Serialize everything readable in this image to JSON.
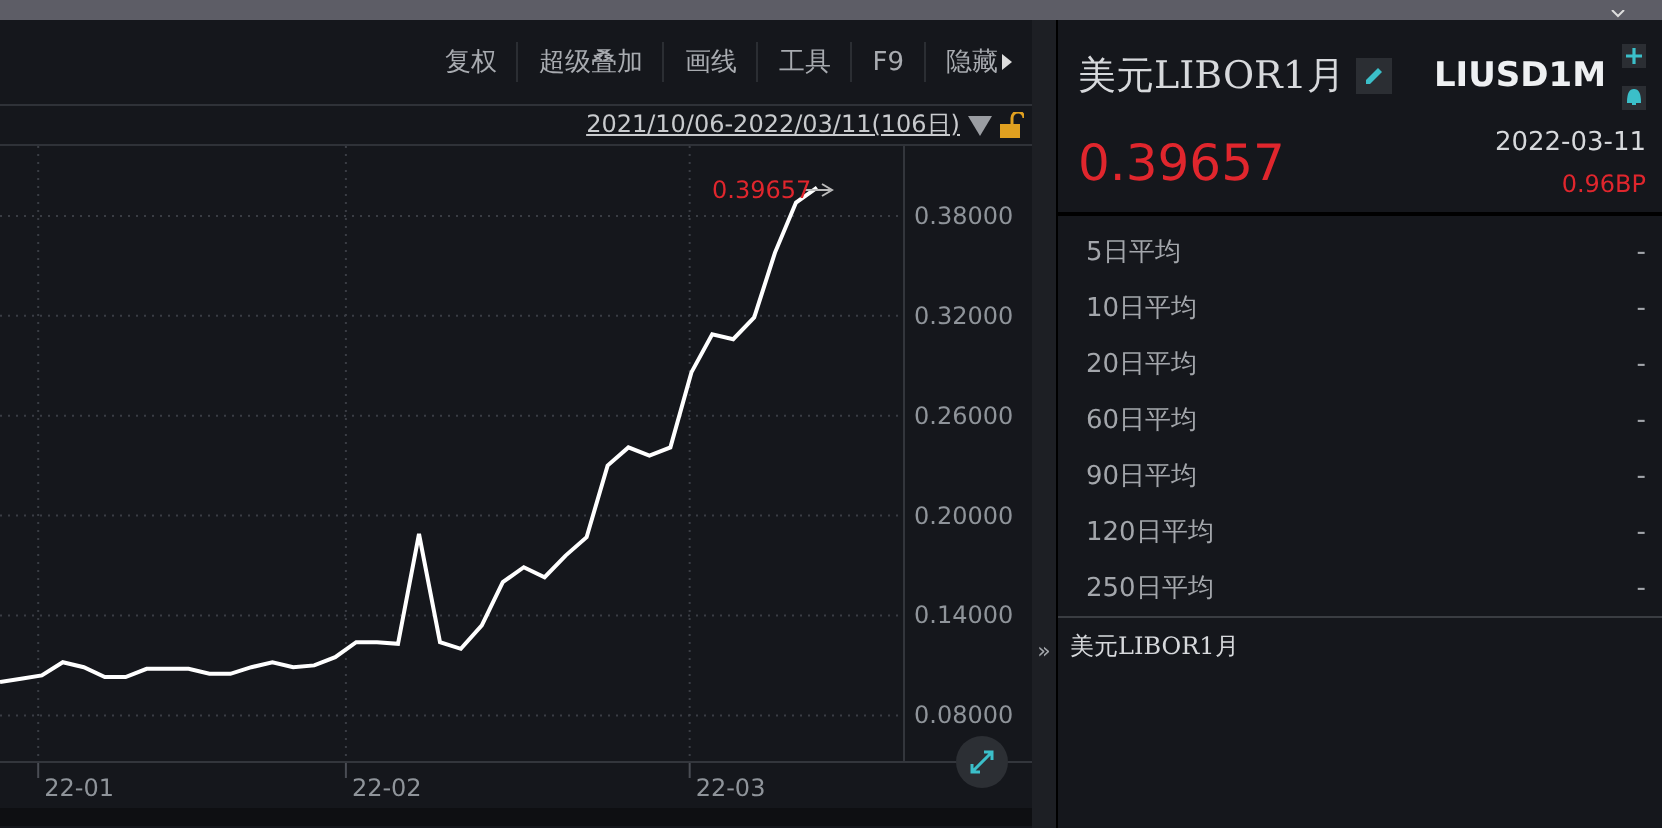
{
  "toolbar": {
    "items": [
      "复权",
      "超级叠加",
      "画线",
      "工具",
      "F9",
      "隐藏"
    ]
  },
  "range": {
    "label": "2021/10/06-2022/03/11(106日)"
  },
  "chart": {
    "last_value_label": "0.39657",
    "x_axis_labels": [
      "22-01",
      "22-02",
      "22-03"
    ],
    "chart_data": {
      "type": "line",
      "grid": true,
      "ylim": [
        0.052,
        0.422
      ],
      "yticks": [
        {
          "value": 0.08,
          "label": "0.08000"
        },
        {
          "value": 0.14,
          "label": "0.14000"
        },
        {
          "value": 0.2,
          "label": "0.20000"
        },
        {
          "value": 0.26,
          "label": "0.26000"
        },
        {
          "value": 0.32,
          "label": "0.32000"
        },
        {
          "value": 0.38,
          "label": "0.38000"
        }
      ],
      "series": [
        {
          "color": "#ffffff",
          "values": [
            0.1,
            0.102,
            0.104,
            0.112,
            0.109,
            0.103,
            0.103,
            0.108,
            0.108,
            0.108,
            0.105,
            0.105,
            0.109,
            0.112,
            0.109,
            0.11,
            0.115,
            0.124,
            0.124,
            0.123,
            0.189,
            0.124,
            0.12,
            0.134,
            0.16,
            0.169,
            0.163,
            0.176,
            0.187,
            0.23,
            0.241,
            0.236,
            0.241,
            0.286,
            0.309,
            0.306,
            0.319,
            0.358,
            0.388,
            0.397
          ]
        }
      ]
    }
  },
  "expand_toggle": "»",
  "quote": {
    "name": "美元LIBOR1月",
    "code": "LIUSD1M",
    "price": "0.39657",
    "date": "2022-03-11",
    "change": "0.96BP"
  },
  "averages": [
    {
      "label": "5日平均",
      "value": "-"
    },
    {
      "label": "10日平均",
      "value": "-"
    },
    {
      "label": "20日平均",
      "value": "-"
    },
    {
      "label": "60日平均",
      "value": "-"
    },
    {
      "label": "90日平均",
      "value": "-"
    },
    {
      "label": "120日平均",
      "value": "-"
    },
    {
      "label": "250日平均",
      "value": "-"
    }
  ],
  "note": "美元LIBOR1月"
}
